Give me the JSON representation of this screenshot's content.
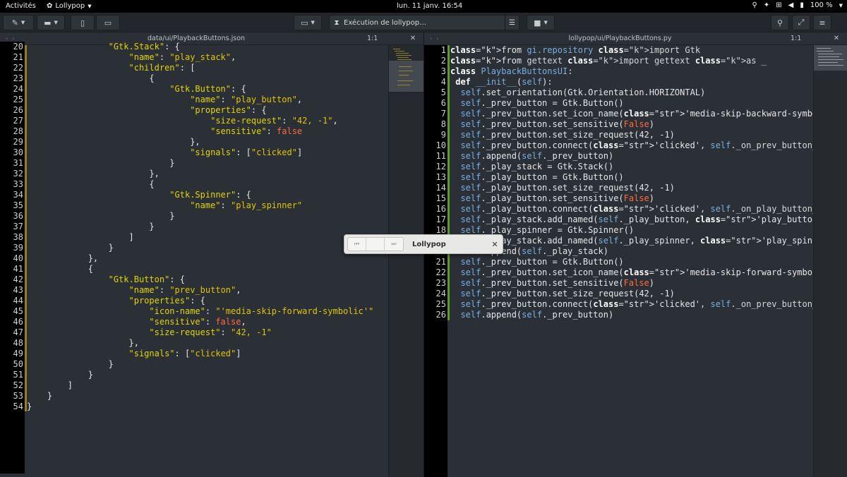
{
  "topbar": {
    "activities": "Activités",
    "app_name": "Lollypop",
    "clock": "lun. 11 janv.  16:54",
    "battery": "100 %"
  },
  "header": {
    "run_status": "Exécution de lollypop…"
  },
  "left_tab": {
    "file": "data/ui/PlaybackButtons.json",
    "position": "1:1"
  },
  "right_tab": {
    "file": "lollypop/ui/PlaybackButtons.py",
    "position": "1:1"
  },
  "left_editor": {
    "lines": [
      {
        "n": "20",
        "t": "                \"Gtk.Stack\": {"
      },
      {
        "n": "21",
        "t": "                    \"name\": \"play_stack\","
      },
      {
        "n": "22",
        "t": "                    \"children\": ["
      },
      {
        "n": "23",
        "t": "                        {"
      },
      {
        "n": "24",
        "t": "                            \"Gtk.Button\": {"
      },
      {
        "n": "25",
        "t": "                                \"name\": \"play_button\","
      },
      {
        "n": "26",
        "t": "                                \"properties\": {"
      },
      {
        "n": "27",
        "t": "                                    \"size-request\": \"42, -1\","
      },
      {
        "n": "28",
        "t": "                                    \"sensitive\": false"
      },
      {
        "n": "29",
        "t": "                                },"
      },
      {
        "n": "30",
        "t": "                                \"signals\": [\"clicked\"]"
      },
      {
        "n": "31",
        "t": "                            }"
      },
      {
        "n": "32",
        "t": "                        },"
      },
      {
        "n": "33",
        "t": "                        {"
      },
      {
        "n": "34",
        "t": "                            \"Gtk.Spinner\": {"
      },
      {
        "n": "35",
        "t": "                                \"name\": \"play_spinner\""
      },
      {
        "n": "36",
        "t": "                            }"
      },
      {
        "n": "37",
        "t": "                        }"
      },
      {
        "n": "38",
        "t": "                    ]"
      },
      {
        "n": "39",
        "t": "                }"
      },
      {
        "n": "40",
        "t": "            },"
      },
      {
        "n": "41",
        "t": "            {"
      },
      {
        "n": "42",
        "t": "                \"Gtk.Button\": {"
      },
      {
        "n": "43",
        "t": "                    \"name\": \"prev_button\","
      },
      {
        "n": "44",
        "t": "                    \"properties\": {"
      },
      {
        "n": "45",
        "t": "                        \"icon-name\": \"'media-skip-forward-symbolic'\""
      },
      {
        "n": "46",
        "t": "                        \"sensitive\": false,"
      },
      {
        "n": "47",
        "t": "                        \"size-request\": \"42, -1\""
      },
      {
        "n": "48",
        "t": "                    },"
      },
      {
        "n": "49",
        "t": "                    \"signals\": [\"clicked\"]"
      },
      {
        "n": "50",
        "t": "                }"
      },
      {
        "n": "51",
        "t": "            }"
      },
      {
        "n": "52",
        "t": "        ]"
      },
      {
        "n": "53",
        "t": "    }"
      },
      {
        "n": "54",
        "t": "}"
      }
    ]
  },
  "right_editor": {
    "lines": [
      {
        "n": "1",
        "t": "from gi.repository import Gtk"
      },
      {
        "n": "2",
        "t": "from gettext import gettext as _"
      },
      {
        "n": "3",
        "t": "class PlaybackButtonsUI:"
      },
      {
        "n": "4",
        "t": " def __init__(self):"
      },
      {
        "n": "5",
        "t": "  self.set_orientation(Gtk.Orientation.HORIZONTAL)"
      },
      {
        "n": "6",
        "t": "  self._prev_button = Gtk.Button()"
      },
      {
        "n": "7",
        "t": "  self._prev_button.set_icon_name('media-skip-backward-symbolic')"
      },
      {
        "n": "8",
        "t": "  self._prev_button.set_sensitive(False)"
      },
      {
        "n": "9",
        "t": "  self._prev_button.set_size_request(42, -1)"
      },
      {
        "n": "10",
        "t": "  self._prev_button.connect('clicked', self._on_prev_button_clicked)"
      },
      {
        "n": "11",
        "t": "  self.append(self._prev_button)"
      },
      {
        "n": "12",
        "t": "  self._play_stack = Gtk.Stack()"
      },
      {
        "n": "13",
        "t": "  self._play_button = Gtk.Button()"
      },
      {
        "n": "14",
        "t": "  self._play_button.set_size_request(42, -1)"
      },
      {
        "n": "15",
        "t": "  self._play_button.set_sensitive(False)"
      },
      {
        "n": "16",
        "t": "  self._play_button.connect('clicked', self._on_play_button_clicked)"
      },
      {
        "n": "17",
        "t": "  self._play_stack.add_named(self._play_button, 'play_button')"
      },
      {
        "n": "18",
        "t": "  self._play_spinner = Gtk.Spinner()"
      },
      {
        "n": "19",
        "t": "  self._play_stack.add_named(self._play_spinner, 'play_spinner')"
      },
      {
        "n": "20",
        "t": "  self.append(self._play_stack)"
      },
      {
        "n": "21",
        "t": "  self._prev_button = Gtk.Button()"
      },
      {
        "n": "22",
        "t": "  self._prev_button.set_icon_name('media-skip-forward-symbolic')"
      },
      {
        "n": "23",
        "t": "  self._prev_button.set_sensitive(False)"
      },
      {
        "n": "24",
        "t": "  self._prev_button.set_size_request(42, -1)"
      },
      {
        "n": "25",
        "t": "  self._prev_button.connect('clicked', self._on_prev_button_clicked)"
      },
      {
        "n": "26",
        "t": "  self.append(self._prev_button)"
      }
    ]
  },
  "popup": {
    "title": "Lollypop"
  },
  "icons": {
    "app_menu": "flower-icon",
    "prev": "media-skip-backward-icon",
    "next": "media-skip-forward-icon"
  }
}
